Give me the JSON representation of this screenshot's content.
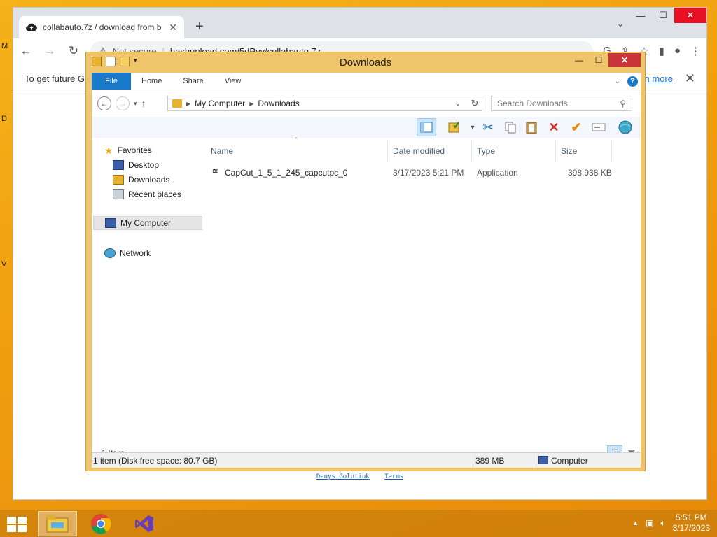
{
  "desktop": {
    "edge_letters": [
      "M",
      "D",
      "V"
    ]
  },
  "chrome": {
    "tab_title": "collabauto.7z / download from b",
    "new_tab": "+",
    "tab_close": "✕",
    "window_controls": {
      "minimize": "—",
      "maximize": "☐",
      "close": "✕"
    },
    "tab_menu": "⌄",
    "back": "←",
    "forward": "→",
    "reload": "↻",
    "security_label": "Not secure",
    "url": "bashupload.com/5dPvy/collabauto.7z",
    "infobar_text": "To get future Go",
    "infobar_link": "n more",
    "infobar_close": "✕",
    "footer_links": [
      "Denys Golotiuk",
      "Terms"
    ]
  },
  "explorer": {
    "title": "Downloads",
    "window_controls": {
      "minimize": "—",
      "maximize": "☐",
      "close": "✕"
    },
    "ribbon_tabs": [
      "File",
      "Home",
      "Share",
      "View"
    ],
    "help": "?",
    "breadcrumb": [
      "My Computer",
      "Downloads"
    ],
    "search_placeholder": "Search Downloads",
    "nav": {
      "favorites": "Favorites",
      "desktop": "Desktop",
      "downloads": "Downloads",
      "recent": "Recent places",
      "computer": "My Computer",
      "network": "Network"
    },
    "columns": {
      "name": "Name",
      "date": "Date modified",
      "type": "Type",
      "size": "Size"
    },
    "files": [
      {
        "name": "CapCut_1_5_1_245_capcutpc_0",
        "date": "3/17/2023 5:21 PM",
        "type": "Application",
        "size": "398,938 KB"
      }
    ],
    "item_count": "1 item",
    "status": {
      "disk": "1 item (Disk free space: 80.7 GB)",
      "size": "389 MB",
      "location": "Computer"
    }
  },
  "taskbar": {
    "time": "5:51 PM",
    "date": "3/17/2023"
  }
}
